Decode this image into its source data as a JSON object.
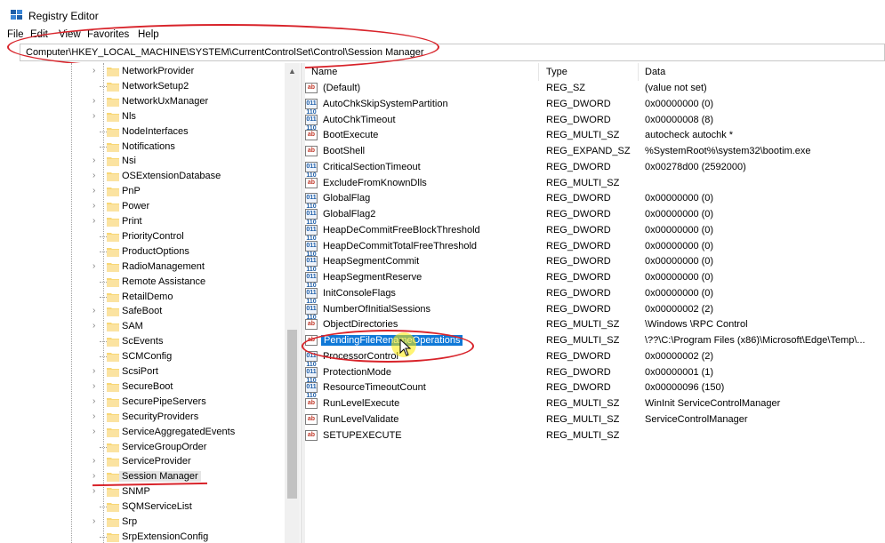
{
  "window": {
    "title": "Registry Editor"
  },
  "menu": [
    "File",
    "Edit",
    "View",
    "Favorites",
    "Help"
  ],
  "address": "Computer\\HKEY_LOCAL_MACHINE\\SYSTEM\\CurrentControlSet\\Control\\Session Manager",
  "tree": {
    "items": [
      {
        "label": "NetworkProvider",
        "expandable": true
      },
      {
        "label": "NetworkSetup2",
        "expandable": false
      },
      {
        "label": "NetworkUxManager",
        "expandable": true
      },
      {
        "label": "Nls",
        "expandable": true
      },
      {
        "label": "NodeInterfaces",
        "expandable": false
      },
      {
        "label": "Notifications",
        "expandable": false
      },
      {
        "label": "Nsi",
        "expandable": true
      },
      {
        "label": "OSExtensionDatabase",
        "expandable": true
      },
      {
        "label": "PnP",
        "expandable": true
      },
      {
        "label": "Power",
        "expandable": true
      },
      {
        "label": "Print",
        "expandable": true
      },
      {
        "label": "PriorityControl",
        "expandable": false
      },
      {
        "label": "ProductOptions",
        "expandable": false
      },
      {
        "label": "RadioManagement",
        "expandable": true
      },
      {
        "label": "Remote Assistance",
        "expandable": false
      },
      {
        "label": "RetailDemo",
        "expandable": false
      },
      {
        "label": "SafeBoot",
        "expandable": true
      },
      {
        "label": "SAM",
        "expandable": true
      },
      {
        "label": "ScEvents",
        "expandable": false
      },
      {
        "label": "SCMConfig",
        "expandable": false
      },
      {
        "label": "ScsiPort",
        "expandable": true
      },
      {
        "label": "SecureBoot",
        "expandable": true
      },
      {
        "label": "SecurePipeServers",
        "expandable": true
      },
      {
        "label": "SecurityProviders",
        "expandable": true
      },
      {
        "label": "ServiceAggregatedEvents",
        "expandable": true
      },
      {
        "label": "ServiceGroupOrder",
        "expandable": false
      },
      {
        "label": "ServiceProvider",
        "expandable": true
      },
      {
        "label": "Session Manager",
        "expandable": true,
        "selected": true
      },
      {
        "label": "SNMP",
        "expandable": true
      },
      {
        "label": "SQMServiceList",
        "expandable": false
      },
      {
        "label": "Srp",
        "expandable": true
      },
      {
        "label": "SrpExtensionConfig",
        "expandable": false
      }
    ]
  },
  "columns": {
    "name": "Name",
    "type": "Type",
    "data": "Data"
  },
  "values": [
    {
      "icon": "ab",
      "name": "(Default)",
      "type": "REG_SZ",
      "data": "(value not set)"
    },
    {
      "icon": "dw",
      "name": "AutoChkSkipSystemPartition",
      "type": "REG_DWORD",
      "data": "0x00000000 (0)"
    },
    {
      "icon": "dw",
      "name": "AutoChkTimeout",
      "type": "REG_DWORD",
      "data": "0x00000008 (8)"
    },
    {
      "icon": "ab",
      "name": "BootExecute",
      "type": "REG_MULTI_SZ",
      "data": "autocheck autochk *"
    },
    {
      "icon": "ab",
      "name": "BootShell",
      "type": "REG_EXPAND_SZ",
      "data": "%SystemRoot%\\system32\\bootim.exe"
    },
    {
      "icon": "dw",
      "name": "CriticalSectionTimeout",
      "type": "REG_DWORD",
      "data": "0x00278d00 (2592000)"
    },
    {
      "icon": "ab",
      "name": "ExcludeFromKnownDlls",
      "type": "REG_MULTI_SZ",
      "data": ""
    },
    {
      "icon": "dw",
      "name": "GlobalFlag",
      "type": "REG_DWORD",
      "data": "0x00000000 (0)"
    },
    {
      "icon": "dw",
      "name": "GlobalFlag2",
      "type": "REG_DWORD",
      "data": "0x00000000 (0)"
    },
    {
      "icon": "dw",
      "name": "HeapDeCommitFreeBlockThreshold",
      "type": "REG_DWORD",
      "data": "0x00000000 (0)"
    },
    {
      "icon": "dw",
      "name": "HeapDeCommitTotalFreeThreshold",
      "type": "REG_DWORD",
      "data": "0x00000000 (0)"
    },
    {
      "icon": "dw",
      "name": "HeapSegmentCommit",
      "type": "REG_DWORD",
      "data": "0x00000000 (0)"
    },
    {
      "icon": "dw",
      "name": "HeapSegmentReserve",
      "type": "REG_DWORD",
      "data": "0x00000000 (0)"
    },
    {
      "icon": "dw",
      "name": "InitConsoleFlags",
      "type": "REG_DWORD",
      "data": "0x00000000 (0)"
    },
    {
      "icon": "dw",
      "name": "NumberOfInitialSessions",
      "type": "REG_DWORD",
      "data": "0x00000002 (2)"
    },
    {
      "icon": "ab",
      "name": "ObjectDirectories",
      "type": "REG_MULTI_SZ",
      "data": "\\Windows \\RPC Control"
    },
    {
      "icon": "ab",
      "name": "PendingFileRenameOperations",
      "type": "REG_MULTI_SZ",
      "data": "\\??\\C:\\Program Files (x86)\\Microsoft\\Edge\\Temp\\...",
      "selected": true
    },
    {
      "icon": "dw",
      "name": "ProcessorControl",
      "type": "REG_DWORD",
      "data": "0x00000002 (2)"
    },
    {
      "icon": "dw",
      "name": "ProtectionMode",
      "type": "REG_DWORD",
      "data": "0x00000001 (1)"
    },
    {
      "icon": "dw",
      "name": "ResourceTimeoutCount",
      "type": "REG_DWORD",
      "data": "0x00000096 (150)"
    },
    {
      "icon": "ab",
      "name": "RunLevelExecute",
      "type": "REG_MULTI_SZ",
      "data": "WinInit ServiceControlManager"
    },
    {
      "icon": "ab",
      "name": "RunLevelValidate",
      "type": "REG_MULTI_SZ",
      "data": "ServiceControlManager"
    },
    {
      "icon": "ab",
      "name": "SETUPEXECUTE",
      "type": "REG_MULTI_SZ",
      "data": ""
    }
  ],
  "icons": {
    "string_value_glyph": "ab",
    "binary_value_glyph": "011 110"
  },
  "colors": {
    "annotation": "#d8232a",
    "selection": "#0f78d7",
    "cursor_highlight": "#ffeb00"
  }
}
